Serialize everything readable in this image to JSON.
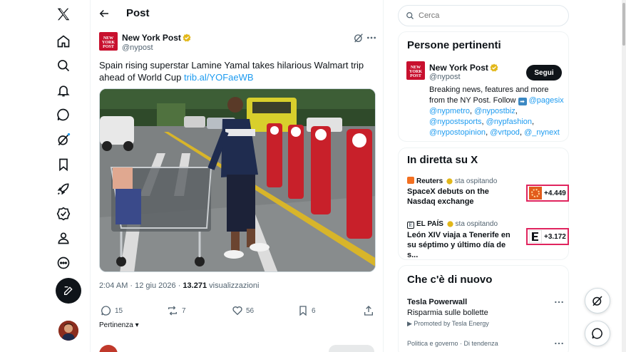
{
  "nav": {
    "logo": "x-logo-icon",
    "items": [
      "home-icon",
      "search-icon",
      "bell-icon",
      "messages-icon",
      "grok-icon",
      "bookmark-icon",
      "rocket-icon",
      "verified-icon",
      "profile-icon",
      "more-circle-icon"
    ],
    "compose": "compose-icon"
  },
  "header": {
    "title": "Post"
  },
  "post": {
    "author_name": "New York Post",
    "author_handle": "@nypost",
    "avatar_text": "NEW YORK POST",
    "text": "Spain rising superstar Lamine Yamal takes hilarious Walmart trip ahead of World Cup",
    "link": "trib.al/YOFaeWB",
    "time": "2:04 AM · 12 giu 2026 · ",
    "views_count": "13.271",
    "views_label": " visualizzazioni",
    "replies": "15",
    "reposts": "7",
    "likes": "56",
    "bookmarks": "6",
    "sort_label": "Pertinenza"
  },
  "sidebar": {
    "search_placeholder": "Cerca",
    "relevant": {
      "title": "Persone pertinenti",
      "name": "New York Post",
      "handle": "@nypost",
      "follow_label": "Segui",
      "bio_start": "Breaking news, features and more from the NY Post. Follow ",
      "bio_links": [
        "@pagesix",
        "@nypmetro",
        "@nypostbiz",
        "@nypostsports",
        "@nypfashion",
        "@nypostopinion",
        "@vrtpod",
        "@_nynext"
      ]
    },
    "live": {
      "title": "In diretta su X",
      "hosting_label": "sta ospitando",
      "items": [
        {
          "source": "Reuters",
          "title": "SpaceX debuts on the Nasdaq exchange",
          "count": "+4.449"
        },
        {
          "source": "EL PAÍS",
          "title": "León XIV viaja a Tenerife en su séptimo y último día de s...",
          "count": "+3.172"
        }
      ]
    },
    "whats_new": {
      "title": "Che c'è di nuovo",
      "trend_title": "Tesla Powerwall",
      "trend_sub": "Risparmia sulle bollette",
      "trend_promo": "Promoted by Tesla Energy",
      "trend2_label": "Politica e governo · Di tendenza"
    }
  },
  "colors": {
    "accent": "#1d9bf0",
    "verified_gold": "#e2b719",
    "brand_red": "#c8102e",
    "badge_border": "#e0245e"
  }
}
